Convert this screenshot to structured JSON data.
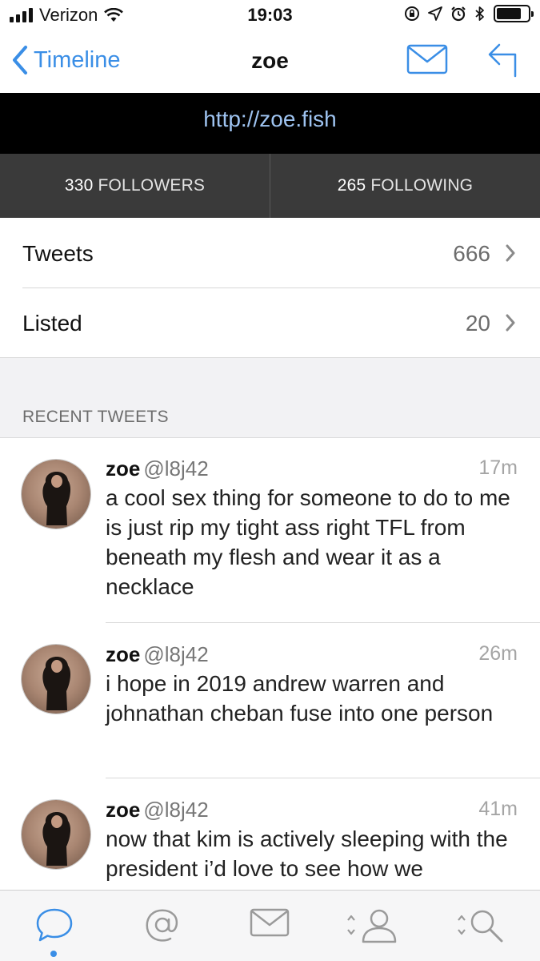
{
  "status_bar": {
    "carrier": "Verizon",
    "time": "19:03"
  },
  "nav": {
    "back_label": "Timeline",
    "title": "zoe"
  },
  "profile": {
    "url": "http://zoe.fish",
    "followers_count": "330",
    "followers_label": "FOLLOWERS",
    "following_count": "265",
    "following_label": "FOLLOWING"
  },
  "rows": [
    {
      "label": "Tweets",
      "count": "666"
    },
    {
      "label": "Listed",
      "count": "20"
    }
  ],
  "section_title": "RECENT TWEETS",
  "tweets": [
    {
      "name": "zoe",
      "handle": "@l8j42",
      "time": "17m",
      "text": "a cool sex thing for someone to do to me is just rip my tight ass right TFL from beneath my flesh and wear it as a necklace"
    },
    {
      "name": "zoe",
      "handle": "@l8j42",
      "time": "26m",
      "text": "i hope in 2019 andrew warren and johnathan cheban fuse into one person"
    },
    {
      "name": "zoe",
      "handle": "@l8j42",
      "time": "41m",
      "text": "now that kim is actively sleeping with the president i’d love to see how we"
    }
  ],
  "tab_bar": {
    "items": [
      "timeline-icon",
      "mentions-icon",
      "messages-icon",
      "profile-icon",
      "search-icon"
    ],
    "active": "timeline-icon"
  },
  "colors": {
    "accent": "#3a8ee6",
    "url_text": "#9ec3f0",
    "stats_bg": "#3a3a3a",
    "url_bg": "#000000"
  }
}
